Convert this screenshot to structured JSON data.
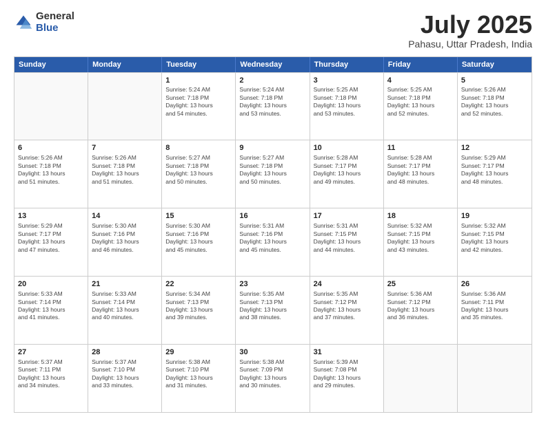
{
  "logo": {
    "general": "General",
    "blue": "Blue"
  },
  "header": {
    "month": "July 2025",
    "location": "Pahasu, Uttar Pradesh, India"
  },
  "weekdays": [
    "Sunday",
    "Monday",
    "Tuesday",
    "Wednesday",
    "Thursday",
    "Friday",
    "Saturday"
  ],
  "weeks": [
    [
      {
        "day": "",
        "info": ""
      },
      {
        "day": "",
        "info": ""
      },
      {
        "day": "1",
        "info": "Sunrise: 5:24 AM\nSunset: 7:18 PM\nDaylight: 13 hours\nand 54 minutes."
      },
      {
        "day": "2",
        "info": "Sunrise: 5:24 AM\nSunset: 7:18 PM\nDaylight: 13 hours\nand 53 minutes."
      },
      {
        "day": "3",
        "info": "Sunrise: 5:25 AM\nSunset: 7:18 PM\nDaylight: 13 hours\nand 53 minutes."
      },
      {
        "day": "4",
        "info": "Sunrise: 5:25 AM\nSunset: 7:18 PM\nDaylight: 13 hours\nand 52 minutes."
      },
      {
        "day": "5",
        "info": "Sunrise: 5:26 AM\nSunset: 7:18 PM\nDaylight: 13 hours\nand 52 minutes."
      }
    ],
    [
      {
        "day": "6",
        "info": "Sunrise: 5:26 AM\nSunset: 7:18 PM\nDaylight: 13 hours\nand 51 minutes."
      },
      {
        "day": "7",
        "info": "Sunrise: 5:26 AM\nSunset: 7:18 PM\nDaylight: 13 hours\nand 51 minutes."
      },
      {
        "day": "8",
        "info": "Sunrise: 5:27 AM\nSunset: 7:18 PM\nDaylight: 13 hours\nand 50 minutes."
      },
      {
        "day": "9",
        "info": "Sunrise: 5:27 AM\nSunset: 7:18 PM\nDaylight: 13 hours\nand 50 minutes."
      },
      {
        "day": "10",
        "info": "Sunrise: 5:28 AM\nSunset: 7:17 PM\nDaylight: 13 hours\nand 49 minutes."
      },
      {
        "day": "11",
        "info": "Sunrise: 5:28 AM\nSunset: 7:17 PM\nDaylight: 13 hours\nand 48 minutes."
      },
      {
        "day": "12",
        "info": "Sunrise: 5:29 AM\nSunset: 7:17 PM\nDaylight: 13 hours\nand 48 minutes."
      }
    ],
    [
      {
        "day": "13",
        "info": "Sunrise: 5:29 AM\nSunset: 7:17 PM\nDaylight: 13 hours\nand 47 minutes."
      },
      {
        "day": "14",
        "info": "Sunrise: 5:30 AM\nSunset: 7:16 PM\nDaylight: 13 hours\nand 46 minutes."
      },
      {
        "day": "15",
        "info": "Sunrise: 5:30 AM\nSunset: 7:16 PM\nDaylight: 13 hours\nand 45 minutes."
      },
      {
        "day": "16",
        "info": "Sunrise: 5:31 AM\nSunset: 7:16 PM\nDaylight: 13 hours\nand 45 minutes."
      },
      {
        "day": "17",
        "info": "Sunrise: 5:31 AM\nSunset: 7:15 PM\nDaylight: 13 hours\nand 44 minutes."
      },
      {
        "day": "18",
        "info": "Sunrise: 5:32 AM\nSunset: 7:15 PM\nDaylight: 13 hours\nand 43 minutes."
      },
      {
        "day": "19",
        "info": "Sunrise: 5:32 AM\nSunset: 7:15 PM\nDaylight: 13 hours\nand 42 minutes."
      }
    ],
    [
      {
        "day": "20",
        "info": "Sunrise: 5:33 AM\nSunset: 7:14 PM\nDaylight: 13 hours\nand 41 minutes."
      },
      {
        "day": "21",
        "info": "Sunrise: 5:33 AM\nSunset: 7:14 PM\nDaylight: 13 hours\nand 40 minutes."
      },
      {
        "day": "22",
        "info": "Sunrise: 5:34 AM\nSunset: 7:13 PM\nDaylight: 13 hours\nand 39 minutes."
      },
      {
        "day": "23",
        "info": "Sunrise: 5:35 AM\nSunset: 7:13 PM\nDaylight: 13 hours\nand 38 minutes."
      },
      {
        "day": "24",
        "info": "Sunrise: 5:35 AM\nSunset: 7:12 PM\nDaylight: 13 hours\nand 37 minutes."
      },
      {
        "day": "25",
        "info": "Sunrise: 5:36 AM\nSunset: 7:12 PM\nDaylight: 13 hours\nand 36 minutes."
      },
      {
        "day": "26",
        "info": "Sunrise: 5:36 AM\nSunset: 7:11 PM\nDaylight: 13 hours\nand 35 minutes."
      }
    ],
    [
      {
        "day": "27",
        "info": "Sunrise: 5:37 AM\nSunset: 7:11 PM\nDaylight: 13 hours\nand 34 minutes."
      },
      {
        "day": "28",
        "info": "Sunrise: 5:37 AM\nSunset: 7:10 PM\nDaylight: 13 hours\nand 33 minutes."
      },
      {
        "day": "29",
        "info": "Sunrise: 5:38 AM\nSunset: 7:10 PM\nDaylight: 13 hours\nand 31 minutes."
      },
      {
        "day": "30",
        "info": "Sunrise: 5:38 AM\nSunset: 7:09 PM\nDaylight: 13 hours\nand 30 minutes."
      },
      {
        "day": "31",
        "info": "Sunrise: 5:39 AM\nSunset: 7:08 PM\nDaylight: 13 hours\nand 29 minutes."
      },
      {
        "day": "",
        "info": ""
      },
      {
        "day": "",
        "info": ""
      }
    ]
  ]
}
